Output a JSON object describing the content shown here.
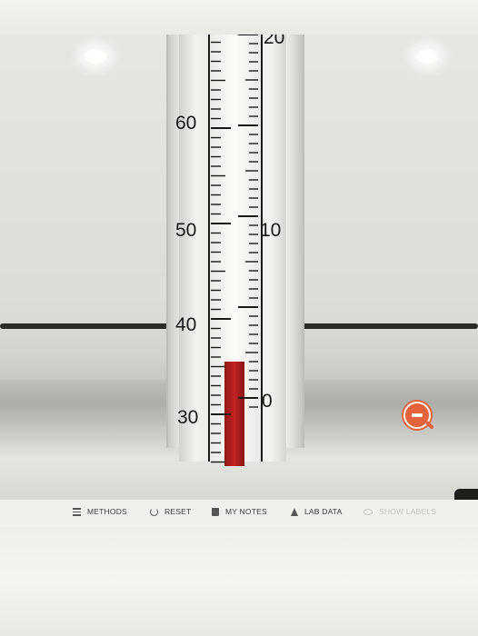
{
  "viewport": {
    "scale_labels": {
      "left_60": "60",
      "left_50": "50",
      "left_40": "40",
      "left_30": "30",
      "right_20": "20",
      "right_10": "10",
      "right_0": "0"
    },
    "zoom_out_icon": "zoom-out-magnifier-icon"
  },
  "toolbar": {
    "methods_label": "METHODS",
    "reset_label": "RESET",
    "my_notes_label": "MY NOTES",
    "lab_data_label": "LAB DATA",
    "show_labels_label": "SHOW LABELS"
  },
  "colors": {
    "accent_zoom": "#e5633a",
    "mercury": "#b51e1e"
  }
}
